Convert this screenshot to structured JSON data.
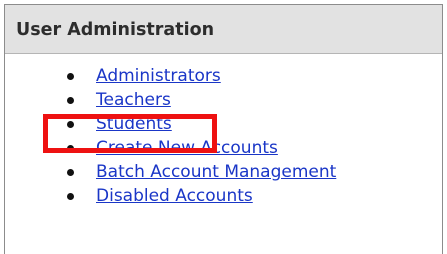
{
  "panel": {
    "title": "User Administration",
    "links": [
      {
        "label": "Administrators"
      },
      {
        "label": "Teachers"
      },
      {
        "label": "Students"
      },
      {
        "label": "Create New Accounts"
      },
      {
        "label": "Batch Account Management"
      },
      {
        "label": "Disabled Accounts"
      }
    ]
  },
  "colors": {
    "link": "#1a36c7",
    "header_bg": "#e2e2e2",
    "highlight": "#ee1111"
  }
}
